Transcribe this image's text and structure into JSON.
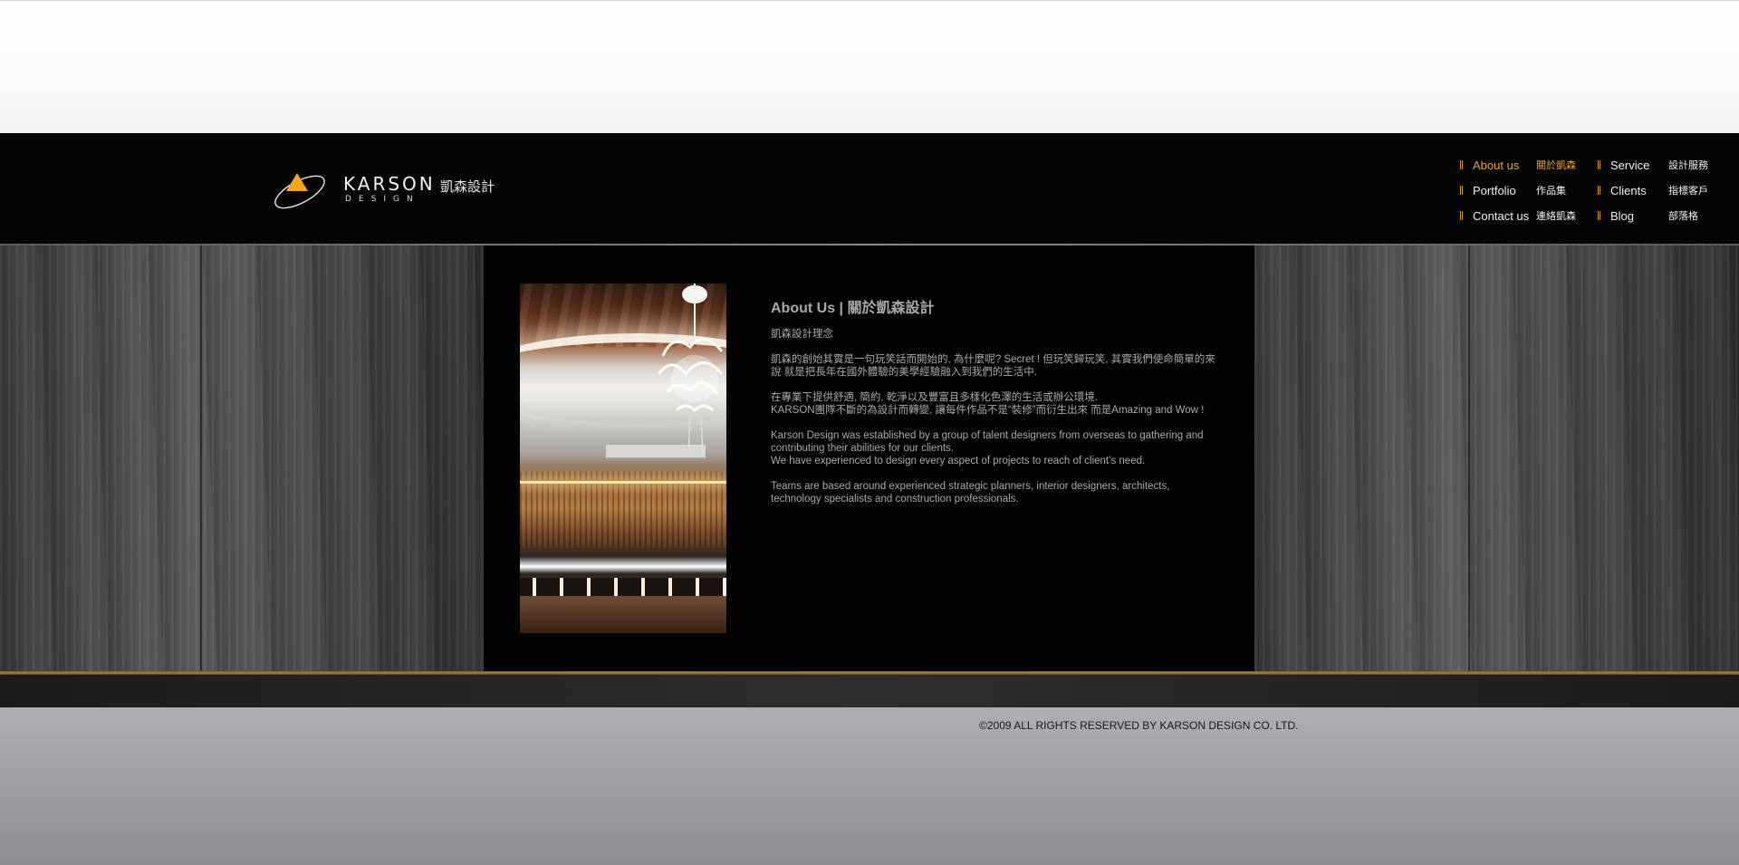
{
  "brand": {
    "wordmark": "KARSON",
    "sub": "DESIGN",
    "chinese": "凱森設計",
    "accent_color": "#f1a81f"
  },
  "nav": {
    "items": [
      {
        "en": "About us",
        "cn": "關於凱森",
        "active": true
      },
      {
        "en": "Service",
        "cn": "設計服務",
        "active": false
      },
      {
        "en": "Portfolio",
        "cn": "作品集",
        "active": false
      },
      {
        "en": "Clients",
        "cn": "指標客戶",
        "active": false
      },
      {
        "en": "Contact us",
        "cn": "連絡凱森",
        "active": false
      },
      {
        "en": "Blog",
        "cn": "部落格",
        "active": false
      }
    ],
    "active_color": "#e7a52d"
  },
  "about": {
    "title": "About Us | 關於凱森設計",
    "subtitle": "凱森設計理念",
    "paragraphs": [
      [
        "凱森的創始其實是一句玩笑話而開始的, 為什麼呢? Secret ! 但玩笑歸玩笑, 其實我們使命簡單的來",
        "說 就是把長年在國外體驗的美學經驗融入到我們的生活中."
      ],
      [
        "在專業下提供舒適, 簡約, 乾淨以及豐富且多樣化色澤的生活或辦公環境.",
        "KARSON團隊不斷的為設計而轉變, 讓每件作品不是“裝修”而衍生出來 而是Amazing and Wow !"
      ],
      [
        "Karson Design was established by a group of talent designers from overseas to gathering and",
        "contributing their abilities for our clients.",
        "We have experienced to design every aspect of projects to reach of client’s need."
      ],
      [
        "Teams are based around experienced strategic planners, interior designers, architects,",
        "technology specialists and construction professionals."
      ]
    ]
  },
  "footer": {
    "copyright": "©2009 ALL RIGHTS RESERVED BY KARSON DESIGN CO. LTD."
  }
}
